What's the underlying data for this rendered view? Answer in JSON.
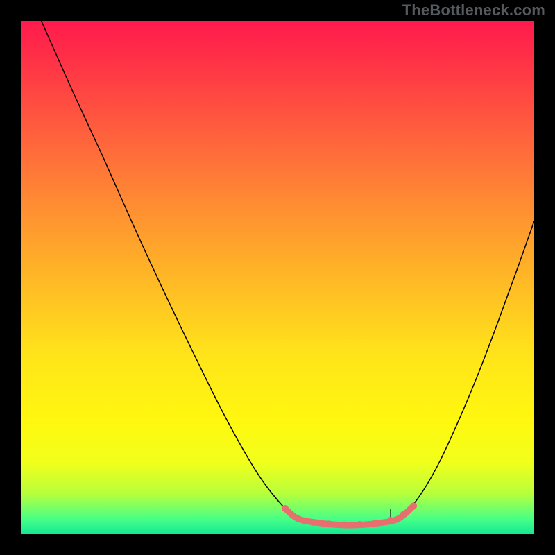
{
  "watermark": "TheBottleneck.com",
  "chart_data": {
    "type": "line",
    "title": "",
    "xlabel": "",
    "ylabel": "",
    "xlim": [
      0,
      100
    ],
    "ylim": [
      0,
      100
    ],
    "grid": false,
    "legend": false,
    "background_gradient": {
      "direction": "vertical",
      "stops": [
        {
          "pos": 0.0,
          "color": "#ff1a4d"
        },
        {
          "pos": 0.07,
          "color": "#ff2f47"
        },
        {
          "pos": 0.2,
          "color": "#ff5a3e"
        },
        {
          "pos": 0.35,
          "color": "#ff8a33"
        },
        {
          "pos": 0.5,
          "color": "#ffb726"
        },
        {
          "pos": 0.65,
          "color": "#ffe41a"
        },
        {
          "pos": 0.78,
          "color": "#fff80f"
        },
        {
          "pos": 0.86,
          "color": "#f1ff1b"
        },
        {
          "pos": 0.92,
          "color": "#b9ff3a"
        },
        {
          "pos": 0.97,
          "color": "#49ff86"
        },
        {
          "pos": 1.0,
          "color": "#12e896"
        }
      ]
    },
    "series": [
      {
        "name": "curve-left",
        "color": "#000000",
        "width": 1.5,
        "points": [
          {
            "x": 4.0,
            "y": 100.0
          },
          {
            "x": 10.0,
            "y": 86.5
          },
          {
            "x": 16.0,
            "y": 73.5
          },
          {
            "x": 22.0,
            "y": 60.0
          },
          {
            "x": 28.0,
            "y": 47.0
          },
          {
            "x": 34.0,
            "y": 34.5
          },
          {
            "x": 40.0,
            "y": 22.5
          },
          {
            "x": 46.0,
            "y": 12.0
          },
          {
            "x": 51.0,
            "y": 5.5
          },
          {
            "x": 54.0,
            "y": 3.0
          }
        ]
      },
      {
        "name": "curve-bottom",
        "color": "#000000",
        "width": 1.5,
        "points": [
          {
            "x": 54.0,
            "y": 3.0
          },
          {
            "x": 58.0,
            "y": 2.2
          },
          {
            "x": 62.0,
            "y": 1.8
          },
          {
            "x": 66.0,
            "y": 1.8
          },
          {
            "x": 70.0,
            "y": 2.2
          },
          {
            "x": 73.5,
            "y": 3.0
          }
        ]
      },
      {
        "name": "curve-right",
        "color": "#000000",
        "width": 1.5,
        "points": [
          {
            "x": 73.5,
            "y": 3.0
          },
          {
            "x": 77.0,
            "y": 6.5
          },
          {
            "x": 81.0,
            "y": 13.0
          },
          {
            "x": 85.0,
            "y": 21.5
          },
          {
            "x": 89.0,
            "y": 31.0
          },
          {
            "x": 93.0,
            "y": 41.5
          },
          {
            "x": 97.0,
            "y": 52.5
          },
          {
            "x": 100.0,
            "y": 61.0
          }
        ]
      },
      {
        "name": "highlight-band",
        "color": "#e86f6f",
        "width": 9,
        "cap": "round",
        "points": [
          {
            "x": 51.5,
            "y": 5.0
          },
          {
            "x": 54.0,
            "y": 3.0
          },
          {
            "x": 58.0,
            "y": 2.2
          },
          {
            "x": 62.0,
            "y": 1.8
          },
          {
            "x": 66.0,
            "y": 1.8
          },
          {
            "x": 70.0,
            "y": 2.2
          },
          {
            "x": 73.5,
            "y": 3.0
          },
          {
            "x": 76.5,
            "y": 5.5
          }
        ]
      },
      {
        "name": "highlight-dots",
        "color": "#e86f6f",
        "type": "scatter",
        "radius": 5,
        "points": [
          {
            "x": 51.5,
            "y": 5.0
          },
          {
            "x": 54.0,
            "y": 3.0
          },
          {
            "x": 57.0,
            "y": 2.3
          },
          {
            "x": 60.0,
            "y": 2.0
          },
          {
            "x": 63.0,
            "y": 1.8
          },
          {
            "x": 66.0,
            "y": 1.9
          },
          {
            "x": 69.0,
            "y": 2.2
          },
          {
            "x": 72.0,
            "y": 2.7
          },
          {
            "x": 74.5,
            "y": 3.8
          },
          {
            "x": 76.5,
            "y": 5.5
          }
        ]
      }
    ],
    "ticks": {
      "x_minor": [
        72.0
      ],
      "tick_length": 3,
      "tick_color": "#2a2a2a"
    }
  }
}
